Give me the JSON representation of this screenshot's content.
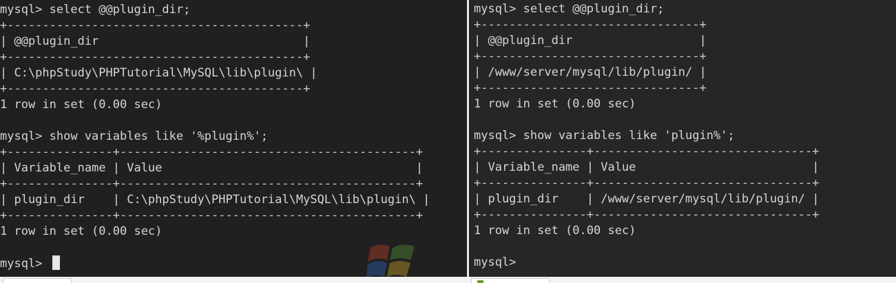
{
  "left_terminal": {
    "lines": [
      "mysql> select @@plugin_dir;",
      "+------------------------------------------+",
      "| @@plugin_dir                             |",
      "+------------------------------------------+",
      "| C:\\phpStudy\\PHPTutorial\\MySQL\\lib\\plugin\\ |",
      "+------------------------------------------+",
      "1 row in set (0.00 sec)",
      "",
      "mysql> show variables like '%plugin%';",
      "+---------------+------------------------------------------+",
      "| Variable_name | Value                                    |",
      "+---------------+------------------------------------------+",
      "| plugin_dir    | C:\\phpStudy\\PHPTutorial\\MySQL\\lib\\plugin\\ |",
      "+---------------+------------------------------------------+",
      "1 row in set (0.00 sec)",
      "",
      "mysql> "
    ],
    "prompt": "mysql> "
  },
  "right_terminal": {
    "lines": [
      "mysql> select @@plugin_dir;",
      "+-------------------------------+",
      "| @@plugin_dir                  |",
      "+-------------------------------+",
      "| /www/server/mysql/lib/plugin/ |",
      "+-------------------------------+",
      "1 row in set (0.00 sec)",
      "",
      "mysql> show variables like 'plugin%';",
      "+---------------+-------------------------------+",
      "| Variable_name | Value                         |",
      "+---------------+-------------------------------+",
      "| plugin_dir    | /www/server/mysql/lib/plugin/ |",
      "+---------------+-------------------------------+",
      "1 row in set (0.00 sec)",
      "",
      "mysql>"
    ]
  },
  "colors": {
    "left_background": "#202020",
    "right_background": "#262626",
    "text": "#d6d6d6",
    "cursor": "#e6e6e6"
  },
  "icons": [
    "windows-logo-icon",
    "app-tab-icon"
  ]
}
